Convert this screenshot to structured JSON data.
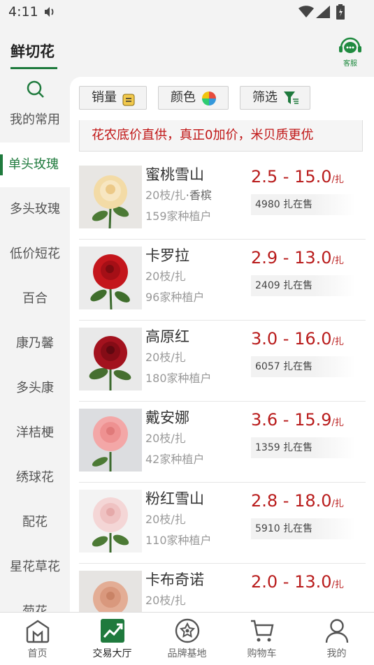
{
  "status_bar": {
    "time": "4:11"
  },
  "header": {
    "title": "鲜切花",
    "service_label": "客服"
  },
  "sidebar": {
    "items": [
      {
        "label": "我的常用"
      },
      {
        "label": "单头玫瑰",
        "active": true
      },
      {
        "label": "多头玫瑰"
      },
      {
        "label": "低价短花"
      },
      {
        "label": "百合"
      },
      {
        "label": "康乃馨"
      },
      {
        "label": "多头康"
      },
      {
        "label": "洋桔梗"
      },
      {
        "label": "绣球花"
      },
      {
        "label": "配花"
      },
      {
        "label": "星花草花"
      },
      {
        "label": "菊花"
      }
    ]
  },
  "filters": {
    "sales": "销量",
    "color": "颜色",
    "filter": "筛选"
  },
  "notice": "花农底价直供，真正0加价，米贝质更优",
  "products": [
    {
      "name": "蜜桃雪山",
      "spec": "20枝/扎",
      "tag": "香槟",
      "growers": "159家种植户",
      "price": "2.5 - 15.0",
      "unit": "/扎",
      "stock": "4980 扎在售",
      "color": "#f3dba6"
    },
    {
      "name": "卡罗拉",
      "spec": "20枝/扎",
      "tag": "",
      "growers": "96家种植户",
      "price": "2.9 - 13.0",
      "unit": "/扎",
      "stock": "2409 扎在售",
      "color": "#c4161c"
    },
    {
      "name": "高原红",
      "spec": "20枝/扎",
      "tag": "",
      "growers": "180家种植户",
      "price": "3.0 - 16.0",
      "unit": "/扎",
      "stock": "6057 扎在售",
      "color": "#a3121e"
    },
    {
      "name": "戴安娜",
      "spec": "20枝/扎",
      "tag": "",
      "growers": "42家种植户",
      "price": "3.6 - 15.9",
      "unit": "/扎",
      "stock": "1359 扎在售",
      "color": "#f3a7a7"
    },
    {
      "name": "粉红雪山",
      "spec": "20枝/扎",
      "tag": "",
      "growers": "110家种植户",
      "price": "2.8 - 18.0",
      "unit": "/扎",
      "stock": "5910 扎在售",
      "color": "#f4d6d6"
    },
    {
      "name": "卡布奇诺",
      "spec": "20枝/扎",
      "tag": "",
      "growers": "",
      "price": "2.0 - 13.0",
      "unit": "/扎",
      "stock": "",
      "color": "#e3ad95"
    }
  ],
  "bottom_nav": [
    {
      "label": "首页",
      "icon": "home-icon"
    },
    {
      "label": "交易大厅",
      "icon": "trade-hall-icon",
      "active": true
    },
    {
      "label": "品牌基地",
      "icon": "brand-base-icon"
    },
    {
      "label": "购物车",
      "icon": "cart-icon"
    },
    {
      "label": "我的",
      "icon": "profile-icon"
    }
  ],
  "colors": {
    "accent": "#1f7a3d",
    "price": "#b91c1c"
  }
}
